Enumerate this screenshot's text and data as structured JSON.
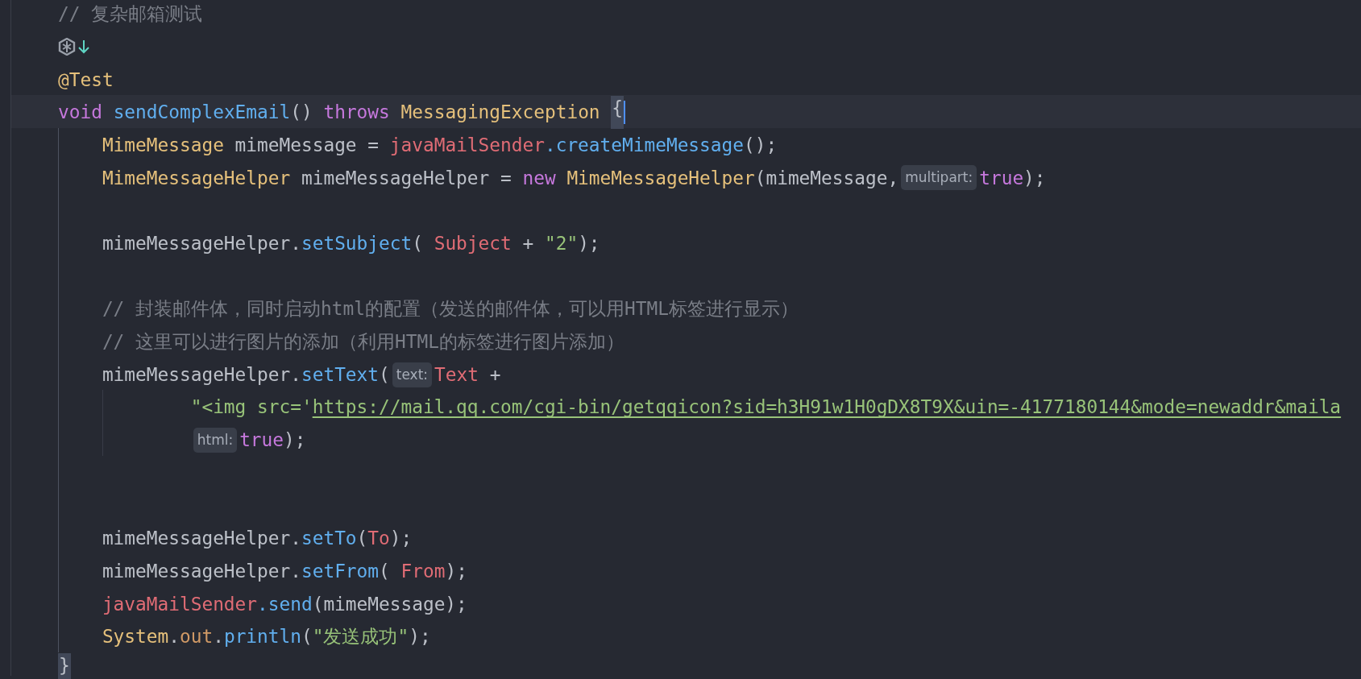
{
  "editor": {
    "lines": [
      {
        "kind": "code",
        "current": false,
        "tokens": [
          {
            "kind": "comment",
            "text": "// 复杂邮箱测试"
          }
        ]
      },
      {
        "kind": "icons",
        "current": false
      },
      {
        "kind": "code",
        "current": false,
        "tokens": [
          {
            "kind": "annotation",
            "text": "@Test"
          }
        ]
      },
      {
        "kind": "code",
        "current": true,
        "tokens": [
          {
            "kind": "keyword",
            "text": "void "
          },
          {
            "kind": "method",
            "text": "sendComplexEmail"
          },
          {
            "kind": "plain",
            "text": "() "
          },
          {
            "kind": "keyword",
            "text": "throws "
          },
          {
            "kind": "type",
            "text": "MessagingException "
          },
          {
            "kind": "brace",
            "text": "{",
            "matched": true
          }
        ],
        "children": [
          {
            "kind": "code",
            "current": false,
            "tokens": [
              {
                "kind": "type",
                "text": "MimeMessage "
              },
              {
                "kind": "plain",
                "text": "mimeMessage = "
              },
              {
                "kind": "field",
                "text": "javaMailSender"
              },
              {
                "kind": "method",
                "text": ".createMimeMessage"
              },
              {
                "kind": "plain",
                "text": "();"
              }
            ]
          },
          {
            "kind": "code",
            "current": false,
            "tokens": [
              {
                "kind": "type",
                "text": "MimeMessageHelper "
              },
              {
                "kind": "plain",
                "text": "mimeMessageHelper = "
              },
              {
                "kind": "keyword",
                "text": "new "
              },
              {
                "kind": "type",
                "text": "MimeMessageHelper"
              },
              {
                "kind": "plain",
                "text": "(mimeMessage,"
              },
              {
                "kind": "hint",
                "text": "multipart:"
              },
              {
                "kind": "keyword",
                "text": "true"
              },
              {
                "kind": "plain",
                "text": ");"
              }
            ]
          },
          {
            "kind": "blank",
            "current": false
          },
          {
            "kind": "code",
            "current": false,
            "tokens": [
              {
                "kind": "plain",
                "text": "mimeMessageHelper."
              },
              {
                "kind": "method",
                "text": "setSubject"
              },
              {
                "kind": "plain",
                "text": "( "
              },
              {
                "kind": "field",
                "text": "Subject"
              },
              {
                "kind": "plain",
                "text": " + "
              },
              {
                "kind": "string",
                "text": "\"2\""
              },
              {
                "kind": "plain",
                "text": ");"
              }
            ]
          },
          {
            "kind": "blank",
            "current": false
          },
          {
            "kind": "code",
            "current": false,
            "tokens": [
              {
                "kind": "comment",
                "text": "// 封装邮件体，同时启动html的配置（发送的邮件体，可以用HTML标签进行显示）"
              }
            ]
          },
          {
            "kind": "code",
            "current": false,
            "tokens": [
              {
                "kind": "comment",
                "text": "// 这里可以进行图片的添加（利用HTML的标签进行图片添加）"
              }
            ]
          },
          {
            "kind": "continued",
            "current": false,
            "tokens": [
              {
                "kind": "plain",
                "text": "mimeMessageHelper."
              },
              {
                "kind": "method",
                "text": "setText"
              },
              {
                "kind": "plain",
                "text": "("
              },
              {
                "kind": "hint",
                "text": "text:"
              },
              {
                "kind": "field",
                "text": "Text"
              },
              {
                "kind": "plain",
                "text": " +"
              }
            ],
            "children": [
              {
                "kind": "code",
                "current": false,
                "tokens": [
                  {
                    "kind": "string",
                    "text": "\"<img src='"
                  },
                  {
                    "kind": "link",
                    "text": "https://mail.qq.com/cgi-bin/getqqicon?sid=h3H91w1H0gDX8T9X&uin=-4177180144&mode=newaddr&maila"
                  }
                ]
              },
              {
                "kind": "code",
                "current": false,
                "tokens": [
                  {
                    "kind": "hint",
                    "text": "html:"
                  },
                  {
                    "kind": "keyword",
                    "text": "true"
                  },
                  {
                    "kind": "plain",
                    "text": ");"
                  }
                ]
              }
            ]
          },
          {
            "kind": "blank",
            "current": false
          },
          {
            "kind": "blank",
            "current": false
          },
          {
            "kind": "code",
            "current": false,
            "tokens": [
              {
                "kind": "plain",
                "text": "mimeMessageHelper."
              },
              {
                "kind": "method",
                "text": "setTo"
              },
              {
                "kind": "plain",
                "text": "("
              },
              {
                "kind": "field",
                "text": "To"
              },
              {
                "kind": "plain",
                "text": ");"
              }
            ]
          },
          {
            "kind": "code",
            "current": false,
            "tokens": [
              {
                "kind": "plain",
                "text": "mimeMessageHelper."
              },
              {
                "kind": "method",
                "text": "setFrom"
              },
              {
                "kind": "plain",
                "text": "( "
              },
              {
                "kind": "field",
                "text": "From"
              },
              {
                "kind": "plain",
                "text": ");"
              }
            ]
          },
          {
            "kind": "code",
            "current": false,
            "tokens": [
              {
                "kind": "field",
                "text": "javaMailSender"
              },
              {
                "kind": "method",
                "text": ".send"
              },
              {
                "kind": "plain",
                "text": "(mimeMessage);"
              }
            ]
          },
          {
            "kind": "code",
            "current": false,
            "tokens": [
              {
                "kind": "type",
                "text": "System"
              },
              {
                "kind": "plain",
                "text": "."
              },
              {
                "kind": "static_field",
                "text": "out"
              },
              {
                "kind": "plain",
                "text": "."
              },
              {
                "kind": "method",
                "text": "println"
              },
              {
                "kind": "plain",
                "text": "("
              },
              {
                "kind": "string",
                "text": "\"发送成功\""
              },
              {
                "kind": "plain",
                "text": ");"
              }
            ]
          }
        ]
      },
      {
        "kind": "code",
        "current": false,
        "tokens": [
          {
            "kind": "brace",
            "text": "}",
            "matched": true
          }
        ]
      }
    ]
  }
}
